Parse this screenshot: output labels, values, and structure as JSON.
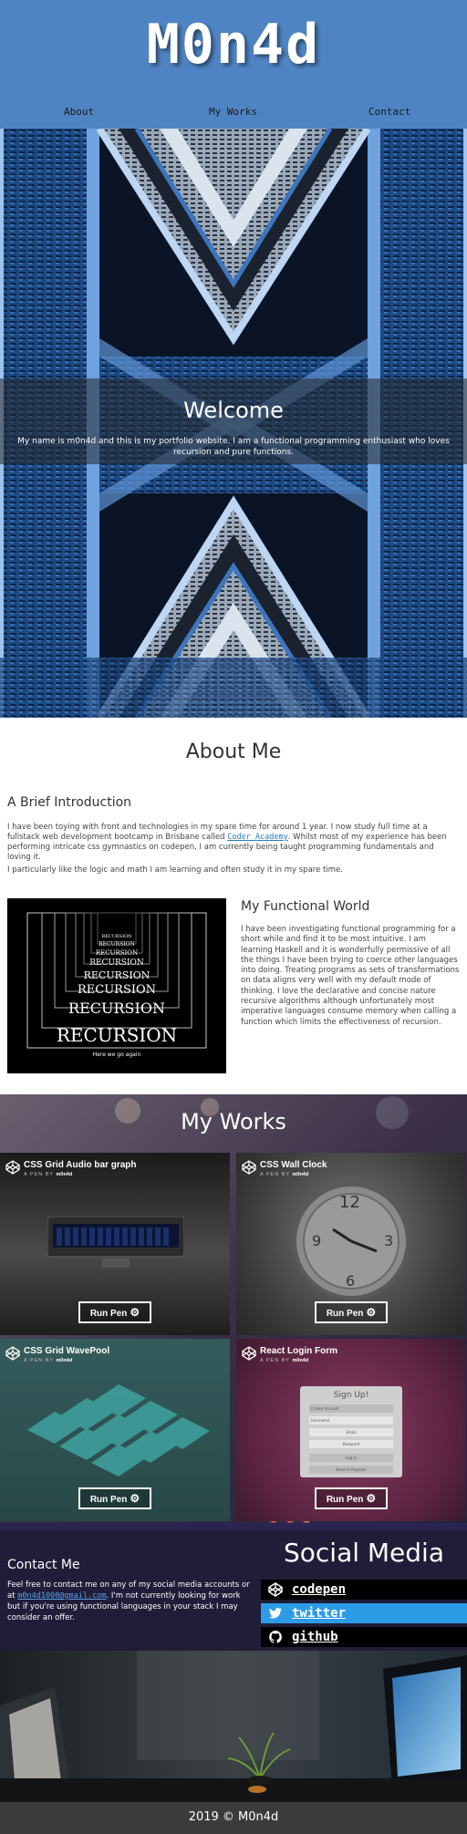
{
  "header": {
    "logo": "M0n4d",
    "nav": [
      "About",
      "My Works",
      "Contact"
    ]
  },
  "hero": {
    "title": "Welcome",
    "text": "My name is m0n4d and this is my portfolio website. I am a functional programming enthusiast who loves recursion and pure functions."
  },
  "about": {
    "title": "About Me",
    "intro_heading": "A Brief Introduction",
    "intro_p1_before": "I have been toying with front and technologies in my spare time for around 1 year. I now study full time at a fullstack web development bootcamp in Brisbane called ",
    "intro_p1_link": "Coder Academy",
    "intro_p1_after": ". Whilst most of my experience has been performing intricate css gymnastics on codepen, I am currently being taught programming fundamentals and loving it.",
    "intro_p2": "I particularly like the logic and math I am learning and often study it in my spare time.",
    "recursion_words": [
      "RECURSION",
      "RECURSION",
      "RECURSION",
      "RECURSION",
      "RECURSION",
      "RECURSION",
      "RECURSION",
      "RECURSION"
    ],
    "recursion_caption": "Here we go again",
    "func_heading": "My Functional World",
    "func_text": "I have been investigating functional programming for a short while and find it to be most intuitive. I am learning Haskell and it is wonderfully permissive of all the things I have been trying to coerce other languages into doing. Treating programs as sets of transformations on data aligns very well with my default mode of thinking. I love the declarative and concise nature recursive algorithms although unfortunately most imperative languages consume memory when calling a function which limits the effectiveness of recursion."
  },
  "works": {
    "title": "My Works",
    "by_label": "A PEN BY",
    "author": "m0n4d",
    "run_label": "Run Pen",
    "pens": [
      {
        "title": "CSS Grid Audio bar graph"
      },
      {
        "title": "CSS Wall Clock",
        "clock_numbers": [
          "12",
          "3",
          "6",
          "9"
        ]
      },
      {
        "title": "CSS Grid WavePool"
      },
      {
        "title": "React Login Form",
        "form_title": "Sign Up!",
        "form_fields": [
          "Create Account",
          "Username",
          "Email",
          "Password",
          "Log in",
          "Need to Register"
        ]
      }
    ]
  },
  "contact": {
    "title": "Contact Me",
    "text_before": "Feel free to contact me on any of my social media accounts or at ",
    "email": "m0n4d1000@gmail.com",
    "text_after": ". I'm not currently looking for work but if you're using functional languages in your stack I may consider an offer."
  },
  "social": {
    "title": "Social Media",
    "items": [
      {
        "label": "codepen",
        "icon": "codepen-icon",
        "bg": "#000000"
      },
      {
        "label": "twitter",
        "icon": "twitter-icon",
        "bg": "#2d9ce6"
      },
      {
        "label": "github",
        "icon": "github-icon",
        "bg": "#000000"
      }
    ]
  },
  "footer": {
    "text": "2019 © M0n4d"
  },
  "colors": {
    "header": "#4f84c4",
    "social_band": "#1f1d38",
    "footer": "#3b3b3b",
    "twitter": "#2d9ce6"
  }
}
